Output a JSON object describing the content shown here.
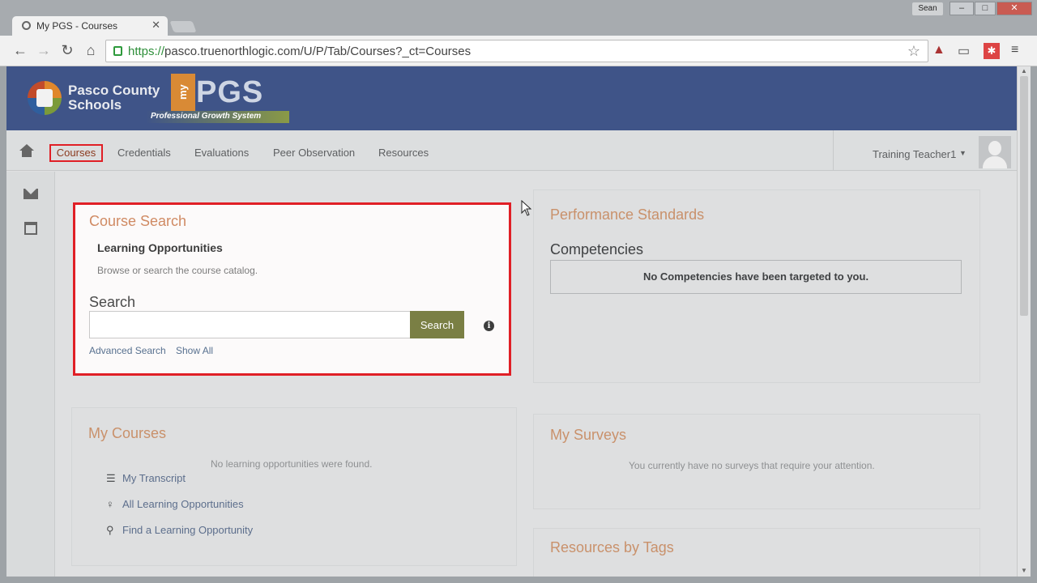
{
  "browser": {
    "tab_title": "My PGS - Courses",
    "user_badge": "Sean",
    "url_scheme": "https://",
    "url_rest": "pasco.truenorthlogic.com/U/P/Tab/Courses?_ct=Courses",
    "window_buttons": [
      "–",
      "□",
      "✕"
    ]
  },
  "banner": {
    "org_line1": "Pasco County",
    "org_line2": "Schools",
    "brand_my": "my",
    "brand_pgs": "PGS",
    "tagline": "Professional Growth System"
  },
  "nav": {
    "items": [
      "Courses",
      "Credentials",
      "Evaluations",
      "Peer Observation",
      "Resources"
    ],
    "user": "Training Teacher1"
  },
  "course_search": {
    "title": "Course Search",
    "subtitle": "Learning Opportunities",
    "description": "Browse or search the course catalog.",
    "search_label": "Search",
    "search_value": "",
    "search_button": "Search",
    "links": [
      "Advanced Search",
      "Show All"
    ]
  },
  "performance": {
    "title": "Performance Standards",
    "competencies_heading": "Competencies",
    "empty_message": "No Competencies have been targeted to you."
  },
  "my_courses": {
    "title": "My Courses",
    "empty_message": "No learning opportunities were found.",
    "links": [
      "My Transcript",
      "All Learning Opportunities",
      "Find a Learning Opportunity"
    ]
  },
  "my_surveys": {
    "title": "My Surveys",
    "empty_message": "You currently have no surveys that require your attention."
  },
  "resources": {
    "title": "Resources by Tags"
  }
}
